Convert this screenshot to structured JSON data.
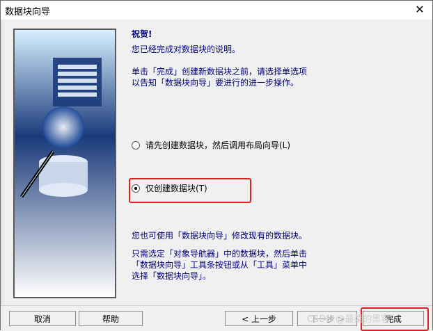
{
  "window": {
    "title": "数据块向导",
    "close_glyph": "✕"
  },
  "content": {
    "heading": "祝贺!",
    "line1": "您已经完成对数据块的说明。",
    "para1_line1": "单击「完成」创建新数据块之前，请选择单选项",
    "para1_line2": "以告知「数据块向导」要进行的进一步操作。",
    "option1": "请先创建数据块，然后调用布局向导(L)",
    "option2": "仅创建数据块(T)",
    "note1": "您也可使用「数据块向导」修改现有的数据块。",
    "note2_line1": "只需选定「对象导航器」中的数据块，然后单击",
    "note2_line2": "「数据块向导」工具条按钮或从「工具」菜单中",
    "note2_line3": "选择「数据块向导」。"
  },
  "buttons": {
    "cancel": "取消",
    "help": "帮助",
    "back": "< 上一步",
    "next": "下一步 >",
    "finish": "完成"
  },
  "watermark": "CSDN @最菜的黑客",
  "colors": {
    "text_blue": "#000080",
    "highlight_red": "#e02020"
  }
}
